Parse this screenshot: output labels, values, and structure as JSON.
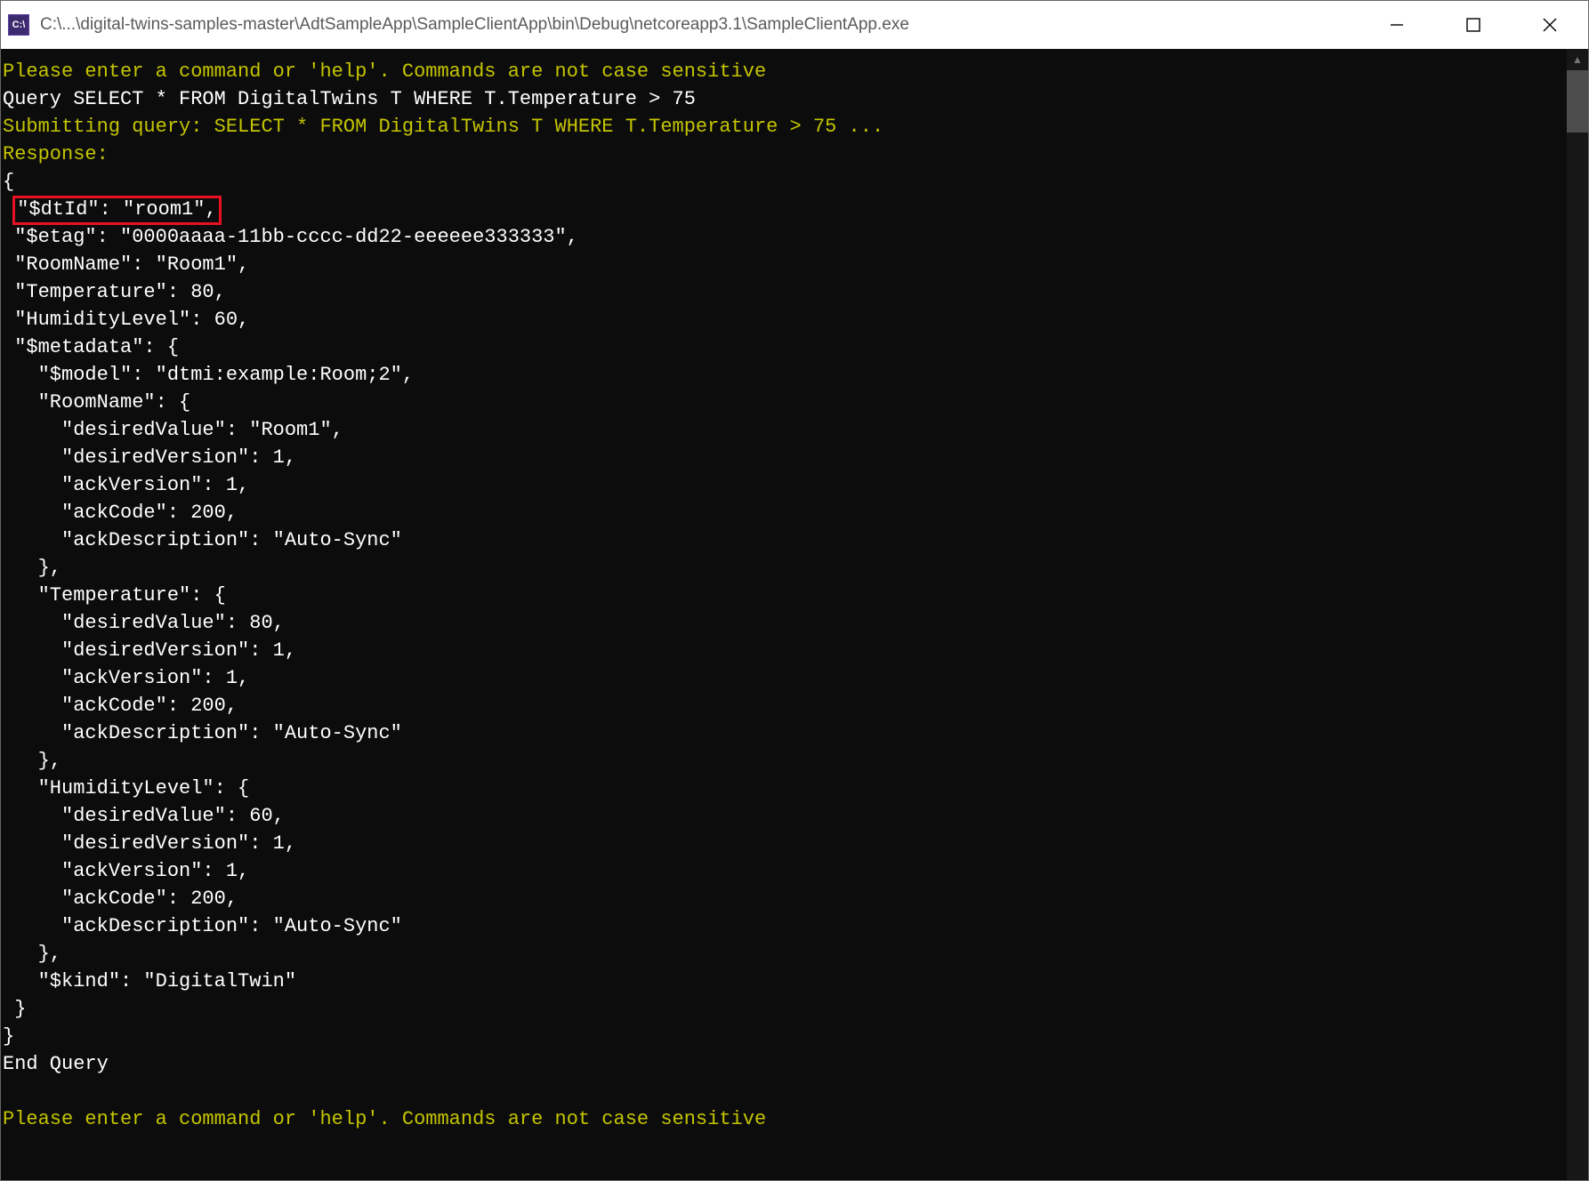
{
  "window": {
    "title": "C:\\...\\digital-twins-samples-master\\AdtSampleApp\\SampleClientApp\\bin\\Debug\\netcoreapp3.1\\SampleClientApp.exe",
    "icon_label": "C:\\"
  },
  "console": {
    "prompt1": "Please enter a command or 'help'. Commands are not case sensitive",
    "query_line": "Query SELECT * FROM DigitalTwins T WHERE T.Temperature > 75",
    "submitting": "Submitting query: SELECT * FROM DigitalTwins T WHERE T.Temperature > 75 ...",
    "response_label": "Response:",
    "brace_open": "{",
    "dtid_line": "\"$dtId\": \"room1\",",
    "etag_line": " \"$etag\": \"0000aaaa-11bb-cccc-dd22-eeeeee333333\",",
    "roomname_line": " \"RoomName\": \"Room1\",",
    "temperature_line": " \"Temperature\": 80,",
    "humidity_line": " \"HumidityLevel\": 60,",
    "metadata_open": " \"$metadata\": {",
    "model_line": "   \"$model\": \"dtmi:example:Room;2\",",
    "md_roomname_open": "   \"RoomName\": {",
    "md_rn_desiredValue": "     \"desiredValue\": \"Room1\",",
    "md_rn_desiredVersion": "     \"desiredVersion\": 1,",
    "md_rn_ackVersion": "     \"ackVersion\": 1,",
    "md_rn_ackCode": "     \"ackCode\": 200,",
    "md_rn_ackDesc": "     \"ackDescription\": \"Auto-Sync\"",
    "md_rn_close": "   },",
    "md_temp_open": "   \"Temperature\": {",
    "md_t_desiredValue": "     \"desiredValue\": 80,",
    "md_t_desiredVersion": "     \"desiredVersion\": 1,",
    "md_t_ackVersion": "     \"ackVersion\": 1,",
    "md_t_ackCode": "     \"ackCode\": 200,",
    "md_t_ackDesc": "     \"ackDescription\": \"Auto-Sync\"",
    "md_t_close": "   },",
    "md_hum_open": "   \"HumidityLevel\": {",
    "md_h_desiredValue": "     \"desiredValue\": 60,",
    "md_h_desiredVersion": "     \"desiredVersion\": 1,",
    "md_h_ackVersion": "     \"ackVersion\": 1,",
    "md_h_ackCode": "     \"ackCode\": 200,",
    "md_h_ackDesc": "     \"ackDescription\": \"Auto-Sync\"",
    "md_h_close": "   },",
    "kind_line": "   \"$kind\": \"DigitalTwin\"",
    "metadata_close": " }",
    "brace_close": "}",
    "end_query": "End Query",
    "blank": "",
    "prompt2": "Please enter a command or 'help'. Commands are not case sensitive"
  }
}
